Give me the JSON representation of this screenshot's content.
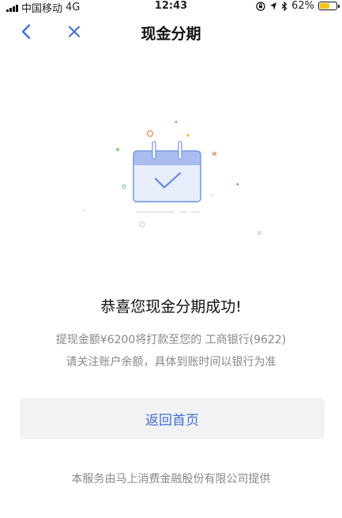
{
  "status_bar": {
    "carrier": "中国移动",
    "network": "4G",
    "time": "12:43",
    "battery_text": "62%",
    "battery_level": 0.62
  },
  "nav": {
    "title": "现金分期",
    "back_icon": "chevron-left-icon",
    "close_icon": "close-icon"
  },
  "main": {
    "success_title": "恭喜您现金分期成功!",
    "line1": "提现金额¥6200将打款至您的 工商银行(9622)",
    "line2": "请关注账户余额，具体到账时间以银行为准",
    "home_button": "返回首页"
  },
  "footer": {
    "text": "本服务由马上消费金融股份有限公司提供"
  },
  "colors": {
    "accent": "#3f6fd9",
    "calendar_header": "#a9bdf0",
    "calendar_body": "#e8eefc"
  }
}
